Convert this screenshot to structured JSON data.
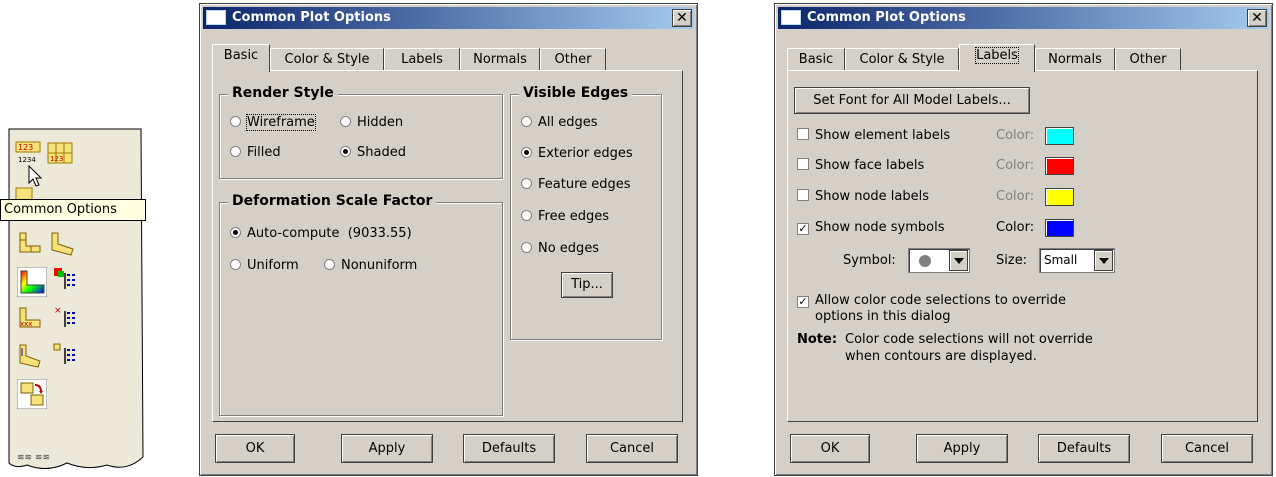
{
  "tooltip": "Common Options",
  "dialog1": {
    "title": "Common Plot Options",
    "tabs": [
      "Basic",
      "Color & Style",
      "Labels",
      "Normals",
      "Other"
    ],
    "active_tab": "Basic",
    "render_style": {
      "title": "Render Style",
      "options": [
        "Wireframe",
        "Hidden",
        "Filled",
        "Shaded"
      ],
      "selected": "Shaded"
    },
    "deformation": {
      "title": "Deformation Scale Factor",
      "auto_label": "Auto-compute",
      "auto_value": "(9033.55)",
      "uniform": "Uniform",
      "nonuniform": "Nonuniform",
      "selected": "Auto-compute"
    },
    "visible_edges": {
      "title": "Visible Edges",
      "options": [
        "All edges",
        "Exterior edges",
        "Feature edges",
        "Free edges",
        "No edges"
      ],
      "selected": "Exterior edges",
      "tip": "Tip..."
    },
    "buttons": [
      "OK",
      "Apply",
      "Defaults",
      "Cancel"
    ]
  },
  "dialog2": {
    "title": "Common Plot Options",
    "tabs": [
      "Basic",
      "Color & Style",
      "Labels",
      "Normals",
      "Other"
    ],
    "active_tab": "Labels",
    "font_button": "Set Font for All Model Labels...",
    "labels": [
      {
        "label": "Show element labels",
        "checked": false,
        "color_label": "Color:",
        "color": "#00ffff"
      },
      {
        "label": "Show face labels",
        "checked": false,
        "color_label": "Color:",
        "color": "#ff0000"
      },
      {
        "label": "Show node labels",
        "checked": false,
        "color_label": "Color:",
        "color": "#ffff00"
      },
      {
        "label": "Show node symbols",
        "checked": true,
        "color_label": "Color:",
        "color": "#0000ff"
      }
    ],
    "symbol_label": "Symbol:",
    "size_label": "Size:",
    "size_value": "Small",
    "allow_override": {
      "line1": "Allow color code selections to override",
      "line2": "options in this dialog",
      "checked": true
    },
    "note": {
      "label": "Note:",
      "line1": "Color code selections will not override",
      "line2": "when contours are displayed."
    },
    "buttons": [
      "OK",
      "Apply",
      "Defaults",
      "Cancel"
    ]
  }
}
